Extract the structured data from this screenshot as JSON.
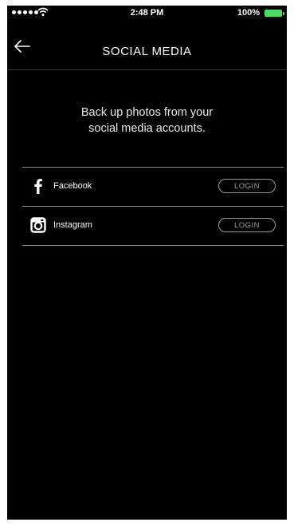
{
  "status_bar": {
    "time": "2:48 PM",
    "battery_percent": "100%",
    "battery_color": "#4cd964"
  },
  "nav": {
    "title": "SOCIAL MEDIA",
    "back_icon": "arrow-left-icon"
  },
  "description": {
    "line1": "Back up photos from your",
    "line2": "social media accounts."
  },
  "accounts": [
    {
      "name": "Facebook",
      "icon": "facebook-icon",
      "button_label": "LOGIN"
    },
    {
      "name": "Instagram",
      "icon": "instagram-icon",
      "button_label": "LOGIN"
    }
  ],
  "colors": {
    "background": "#000000",
    "text": "#ffffff",
    "divider": "#8a8a8a",
    "button_outline": "#9a9a9a"
  }
}
